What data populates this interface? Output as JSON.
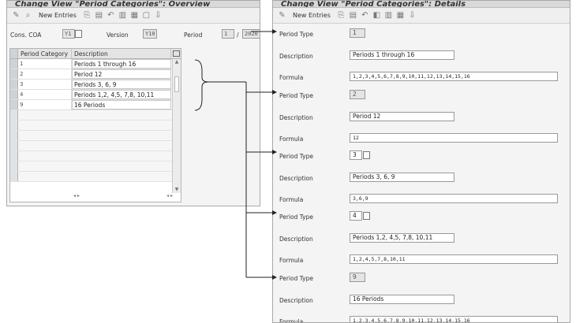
{
  "left": {
    "title": "Change View \"Period Categories\": Overview",
    "toolbar": {
      "new_entries": "New Entries"
    },
    "header": {
      "cons_coa_label": "Cons. COA",
      "cons_coa_value": "Y1",
      "version_label": "Version",
      "version_value": "Y10",
      "period_label": "Period",
      "period_value": "1",
      "period_sep": "/",
      "year_value": "2020"
    },
    "table": {
      "col_category": "Period Category",
      "col_description": "Description",
      "rows": [
        {
          "category": "1",
          "description": "Periods 1 through 16"
        },
        {
          "category": "2",
          "description": "Period 12"
        },
        {
          "category": "3",
          "description": "Periods 3, 6, 9"
        },
        {
          "category": "4",
          "description": "Periods 1,2, 4,5, 7,8, 10,11"
        },
        {
          "category": "9",
          "description": "16 Periods"
        }
      ]
    }
  },
  "right": {
    "title": "Change View \"Period Categories\": Details",
    "toolbar": {
      "new_entries": "New Entries"
    },
    "labels": {
      "period_type": "Period Type",
      "description": "Description",
      "formula": "Formula"
    },
    "groups": [
      {
        "period_type": "1",
        "description": "Periods 1 through 16",
        "formula": "1,2,3,4,5,6,7,8,9,10,11,12,13,14,15,16"
      },
      {
        "period_type": "2",
        "description": "Period 12",
        "formula": "12"
      },
      {
        "period_type": "3",
        "description": "Periods 3, 6, 9",
        "formula": "3,6,9"
      },
      {
        "period_type": "4",
        "description": "Periods 1,2, 4,5, 7,8, 10,11",
        "formula": "1,2,4,5,7,8,10,11"
      },
      {
        "period_type": "9",
        "description": "16 Periods",
        "formula": "1,2,3,4,5,6,7,8,9,10,11,12,13,14,15,16"
      }
    ]
  }
}
